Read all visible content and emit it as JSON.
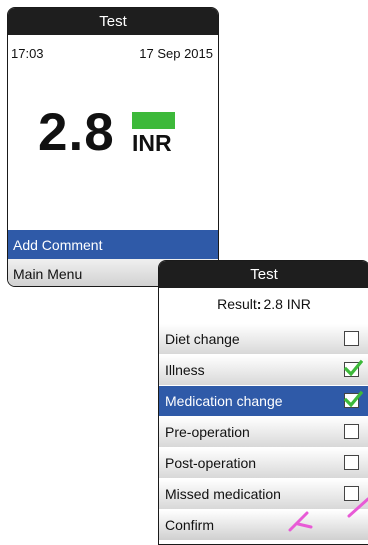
{
  "screen1": {
    "title": "Test",
    "time": "17:03",
    "date": "17 Sep 2015",
    "result_value": "2.8",
    "result_unit": "INR",
    "range_indicator_color": "#3db93a",
    "menu": [
      {
        "label": "Add Comment",
        "selected": true
      },
      {
        "label": "Main Menu",
        "selected": false
      }
    ]
  },
  "screen2": {
    "title": "Test",
    "result_label": "Result",
    "result_value": "2.8 INR",
    "options": [
      {
        "label": "Diet change",
        "checked": false,
        "selected": false
      },
      {
        "label": "Illness",
        "checked": true,
        "selected": false
      },
      {
        "label": "Medication change",
        "checked": true,
        "selected": true
      },
      {
        "label": "Pre-operation",
        "checked": false,
        "selected": false
      },
      {
        "label": "Post-operation",
        "checked": false,
        "selected": false
      },
      {
        "label": "Missed medication",
        "checked": false,
        "selected": false
      }
    ],
    "confirm_label": "Confirm"
  },
  "colors": {
    "title_bar": "#1e1e1e",
    "selection": "#2f5aa8",
    "checkmark": "#3db93a",
    "annotation": "#e85ad6"
  }
}
